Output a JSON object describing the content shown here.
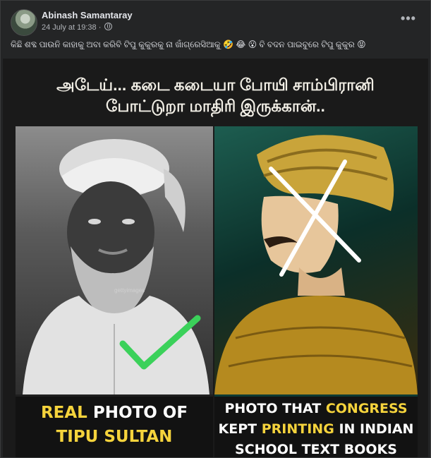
{
  "post": {
    "author": "Abinash Samantaray",
    "timestamp": "24 July at 19:38",
    "more_label": "•••",
    "caption": "କିଛି ଶବ୍ଦ ପାଉନି କାହାକୁ ଅବା କରିବି ଟିପୁ କୁକୁରକୁ ନା ଖାଁଗ୍ରେସିଆକୁ 🤣 😂 😮 ବି ବଦନ ପାଇବୁରେ ଟିପୁ କୁକୁର 😝"
  },
  "media": {
    "headline_line1": "அடேய்... கடை கடையா போயி சாம்பிரானி",
    "headline_line2": "போட்டுறா மாதிரி இருக்கான்..",
    "watermark": "gettyimages",
    "left_label": {
      "word1": "REAL",
      "rest1": "PHOTO OF",
      "line2": "TIPU SULTAN"
    },
    "right_label": {
      "l1_a": "PHOTO THAT",
      "l1_b": "CONGRESS",
      "l2_a": "KEPT",
      "l2_b": "PRINTING",
      "l2_c": "IN INDIAN",
      "l3": "SCHOOL TEXT BOOKS"
    }
  },
  "colors": {
    "background": "#242526",
    "text_primary": "#e4e6eb",
    "text_secondary": "#b0b3b8",
    "label_yellow": "#f5d33c",
    "check_green": "#3bd15a",
    "cross_white": "#ffffff"
  },
  "icons": {
    "globe": "globe-icon",
    "check": "check-mark-icon",
    "cross": "cross-mark-icon"
  }
}
